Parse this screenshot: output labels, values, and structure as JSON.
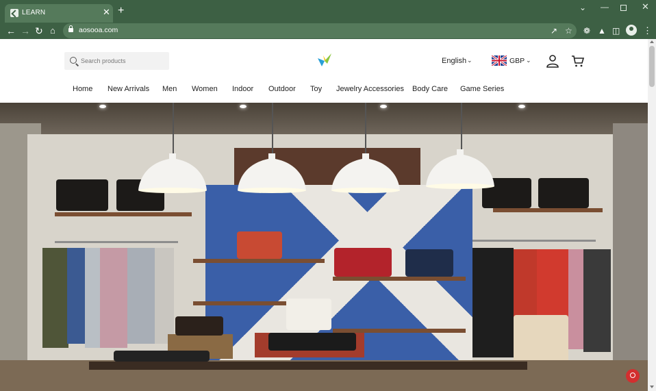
{
  "browser": {
    "tab_title": "LEARN",
    "tab_close": "✕",
    "new_tab": "+",
    "url": "aosooa.com",
    "window_controls": {
      "collapse": "⌄",
      "minimize": "—",
      "close": "✕"
    },
    "toolbar_icons": [
      "back-icon",
      "forward-icon",
      "reload-icon",
      "home-icon",
      "lock-icon",
      "share-icon",
      "star-icon",
      "extensions-icon",
      "labs-icon",
      "sidepanel-icon",
      "profile-icon",
      "menu-icon"
    ]
  },
  "header": {
    "search": {
      "placeholder": "Search products"
    },
    "language": "English",
    "currency": "GBP",
    "lang_chevron": "⌄",
    "currency_chevron": "⌄"
  },
  "nav": {
    "items": [
      {
        "label": "Home"
      },
      {
        "label": "New Arrivals"
      },
      {
        "label": "Men"
      },
      {
        "label": "Women"
      },
      {
        "label": "Indoor"
      },
      {
        "label": "Outdoor"
      },
      {
        "label": "Toy"
      },
      {
        "label": "Jewelry Accessories"
      },
      {
        "label": "Body Care"
      },
      {
        "label": "Game Series"
      }
    ]
  },
  "hero": {
    "image": "clothing-store-interior-photo"
  },
  "colors": {
    "chrome": "#3d6044",
    "tab": "#557a5b",
    "logo_blue": "#2a9fd6",
    "logo_green": "#8cc63f",
    "logo_yellow": "#f5c518",
    "help_badge": "#d32f2f"
  }
}
